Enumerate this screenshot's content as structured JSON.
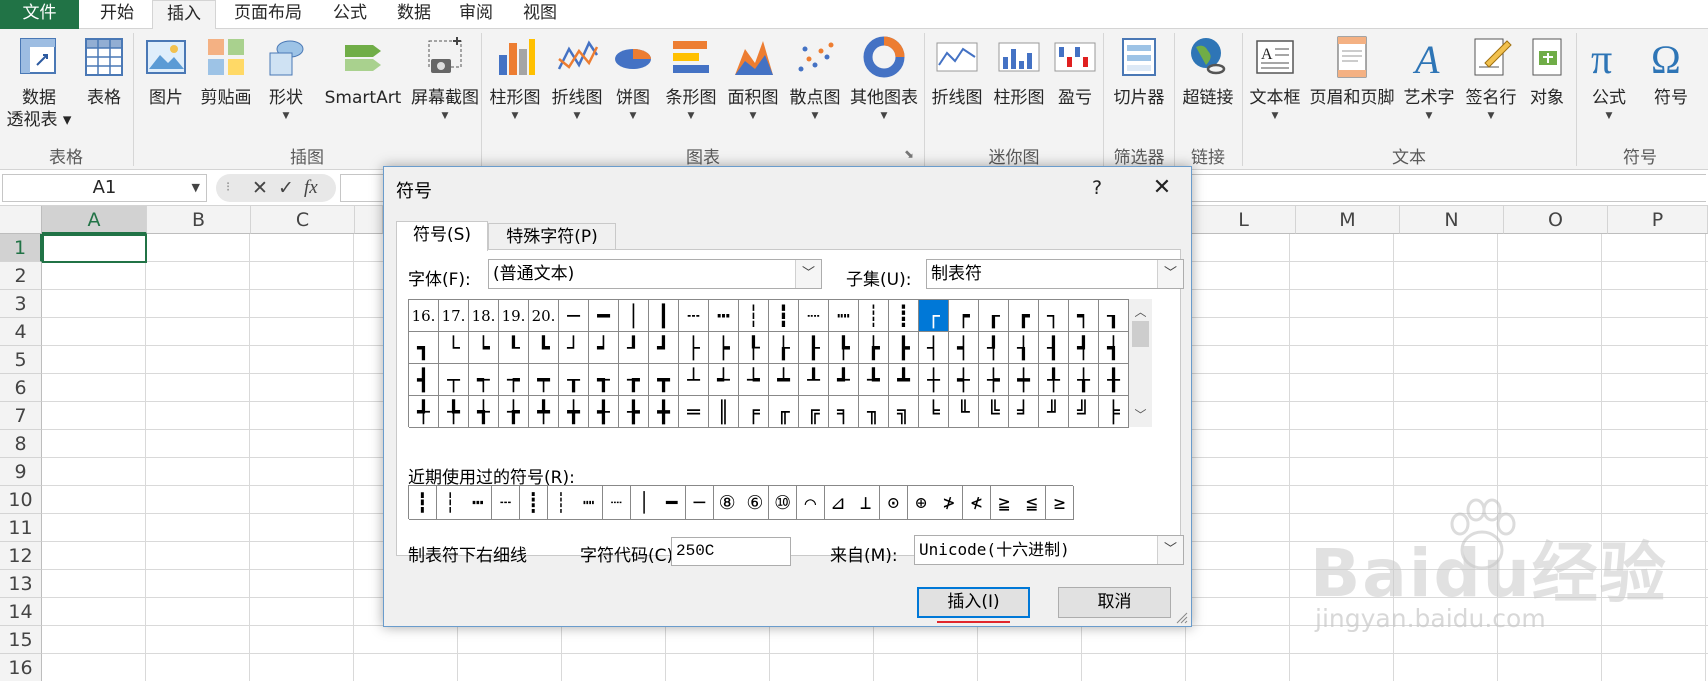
{
  "ribbon_tabs": [
    "文件",
    "开始",
    "插入",
    "页面布局",
    "公式",
    "数据",
    "审阅",
    "视图"
  ],
  "ribbon": {
    "buttons": {
      "pivot": "数据",
      "pivot2": "透视表",
      "table": "表格",
      "picture": "图片",
      "clipart": "剪贴画",
      "shapes": "形状",
      "smartart": "SmartArt",
      "screenshot": "屏幕截图",
      "column": "柱形图",
      "line": "折线图",
      "pie": "饼图",
      "bar": "条形图",
      "area": "面积图",
      "scatter": "散点图",
      "other": "其他图表",
      "sp_line": "折线图",
      "sp_column": "柱形图",
      "sp_winloss": "盈亏",
      "slicer": "切片器",
      "hyperlink": "超链接",
      "textbox": "文本框",
      "header": "页眉和页脚",
      "wordart": "艺术字",
      "signature": "签名行",
      "object": "对象",
      "equation": "公式",
      "symbol": "符号"
    },
    "groups": {
      "tables": "表格",
      "illustrations": "插图",
      "charts": "图表",
      "sparklines": "迷你图",
      "filter": "筛选器",
      "links": "链接",
      "text": "文本",
      "symbols": "符号"
    }
  },
  "formula_bar": {
    "name_box": "A1",
    "fx": "fx",
    "cancel": "✕",
    "enter": "✓"
  },
  "columns": [
    "A",
    "B",
    "C",
    "",
    "",
    "",
    "",
    "",
    "",
    "",
    "",
    "L",
    "M",
    "N",
    "O",
    "P"
  ],
  "rows": [
    "1",
    "2",
    "3",
    "4",
    "5",
    "6",
    "7",
    "8",
    "9",
    "10",
    "11",
    "12",
    "13",
    "14",
    "15",
    "16"
  ],
  "dialog": {
    "title": "符号",
    "help": "?",
    "close": "✕",
    "tab_symbols": "符号(S)",
    "tab_special": "特殊字符(P)",
    "font_label": "字体(F):",
    "font_value": "(普通文本)",
    "subset_label": "子集(U):",
    "subset_value": "制表符",
    "symbols": [
      [
        "16.",
        "17.",
        "18.",
        "19.",
        "20.",
        "─",
        "━",
        "│",
        "┃",
        "┄",
        "┅",
        "┆",
        "┇",
        "┈",
        "┉",
        "┊",
        "┋",
        "┌",
        "┍",
        "┎",
        "┏",
        "┐",
        "┑",
        "┒"
      ],
      [
        "┓",
        "└",
        "┕",
        "┖",
        "┗",
        "┘",
        "┙",
        "┚",
        "┛",
        "├",
        "┝",
        "┞",
        "┟",
        "┠",
        "┡",
        "┢",
        "┣",
        "┤",
        "┥",
        "┦",
        "┧",
        "┨",
        "┩",
        "┪"
      ],
      [
        "┫",
        "┬",
        "┭",
        "┮",
        "┯",
        "┰",
        "┱",
        "┲",
        "┳",
        "┴",
        "┵",
        "┶",
        "┷",
        "┸",
        "┹",
        "┺",
        "┻",
        "┼",
        "┽",
        "┾",
        "┿",
        "╀",
        "╁",
        "╂"
      ],
      [
        "╃",
        "╄",
        "╅",
        "╆",
        "╇",
        "╈",
        "╉",
        "╊",
        "╋",
        "═",
        "║",
        "╒",
        "╓",
        "╔",
        "╕",
        "╖",
        "╗",
        "╘",
        "╙",
        "╚",
        "╛",
        "╜",
        "╝",
        "╞"
      ]
    ],
    "recent_label": "近期使用过的符号(R):",
    "recent": [
      "┇",
      "┆",
      "┅",
      "┄",
      "┋",
      "┊",
      "┉",
      "┈",
      "│",
      "━",
      "─",
      "⑧",
      "⑥",
      "⑩",
      "⌒",
      "⊿",
      "⊥",
      "⊙",
      "⊕",
      "≯",
      "≮",
      "≧",
      "≦",
      "≥"
    ],
    "char_name": "制表符下右细线",
    "code_label": "字符代码(C):",
    "code_value": "250C",
    "from_label": "来自(M):",
    "from_value": "Unicode(十六进制)",
    "insert": "插入(I)",
    "cancel": "取消"
  },
  "watermark": {
    "brand": "Baidu经验",
    "url": "jingyan.baidu.com"
  },
  "colors": {
    "excel_green": "#217346",
    "selection_blue": "#0078d7",
    "underline_red": "#e1262c"
  }
}
